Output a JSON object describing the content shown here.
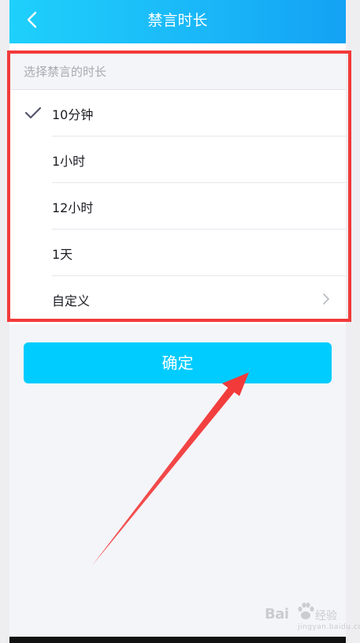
{
  "header": {
    "title": "禁言时长",
    "back_icon": "chevron-left-icon"
  },
  "section": {
    "label": "选择禁言的时长"
  },
  "options": [
    {
      "label": "10分钟",
      "selected": true,
      "icon": "check-icon"
    },
    {
      "label": "1小时",
      "selected": false
    },
    {
      "label": "12小时",
      "selected": false
    },
    {
      "label": "1天",
      "selected": false
    },
    {
      "label": "自定义",
      "selected": false,
      "icon": "chevron-right-icon"
    }
  ],
  "confirm": {
    "label": "确定"
  },
  "watermark": {
    "brand": "Bai",
    "name": "经验",
    "sub": "jingyan.baidu.com"
  },
  "colors": {
    "header_start": "#1ed0fb",
    "header_end": "#14a2f4",
    "button": "#00ccff",
    "annotation_red": "#f23a3a",
    "check": "#53566b"
  }
}
